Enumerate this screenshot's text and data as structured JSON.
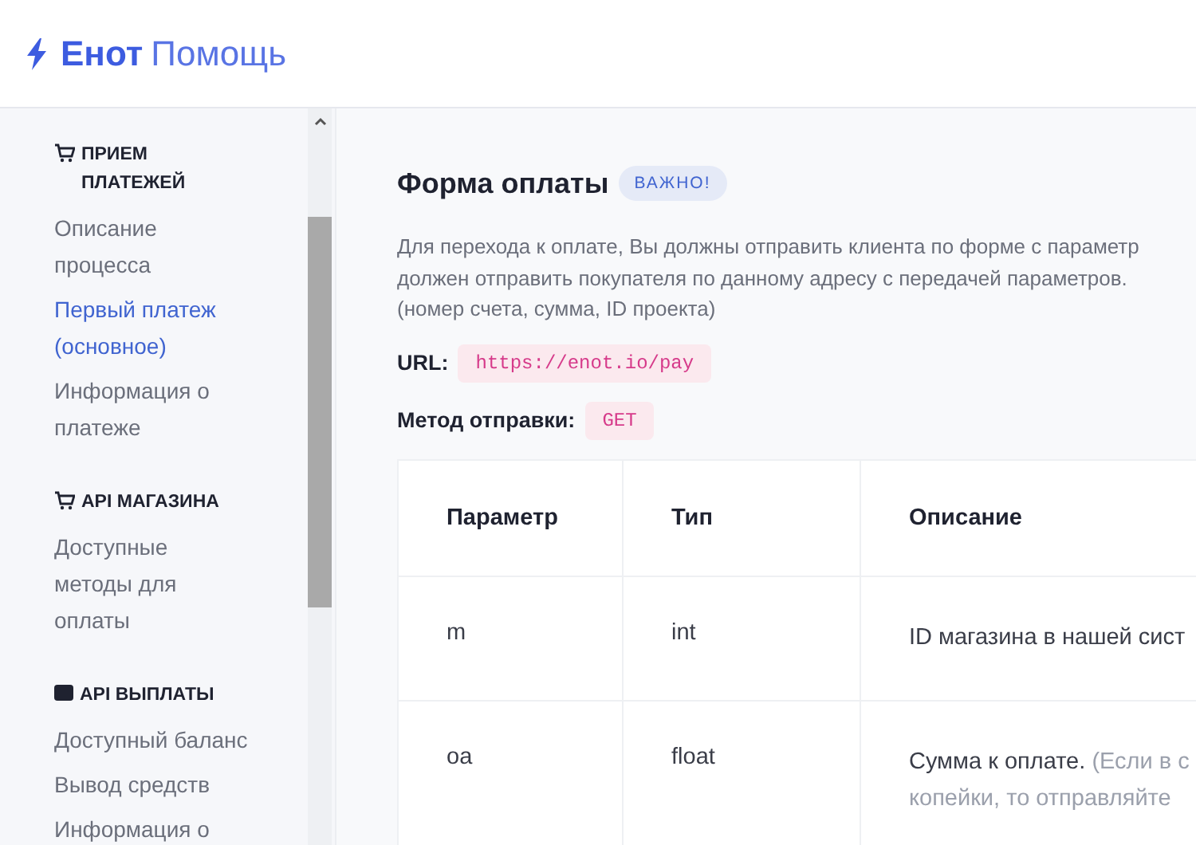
{
  "header": {
    "logo_bold": "Енот",
    "logo_light": "Помощь"
  },
  "sidebar": {
    "sections": [
      {
        "title": "ПРИЕМ\nПЛАТЕЖЕЙ",
        "items": [
          {
            "label": "Описание\nпроцесса",
            "selected": false
          },
          {
            "label": "Первый платеж\n(основное)",
            "selected": true
          },
          {
            "label": "Информация о\nплатеже",
            "selected": false
          }
        ]
      },
      {
        "title": "API МАГАЗИНА",
        "items": [
          {
            "label": "Доступные\nметоды для\nоплаты",
            "selected": false
          }
        ]
      },
      {
        "title": "API ВЫПЛАТЫ",
        "items": [
          {
            "label": "Доступный баланс",
            "selected": false
          },
          {
            "label": "Вывод средств",
            "selected": false
          },
          {
            "label": "Информация о",
            "selected": false
          }
        ]
      }
    ]
  },
  "content": {
    "title": "Форма оплаты",
    "badge": "ВАЖНО!",
    "paragraph": "Для перехода к оплате, Вы должны отправить клиента по форме с параметр\nдолжен отправить покупателя по данному адресу с передачей параметров.\n(номер счета, сумма, ID проекта)",
    "fields": [
      {
        "label": "URL:",
        "value": "https://enot.io/pay"
      },
      {
        "label": "Метод отправки:",
        "value": "GET"
      }
    ],
    "table": {
      "columns": [
        "Параметр",
        "Тип",
        "Описание"
      ],
      "rows": [
        {
          "param": "m",
          "type": "int",
          "description": "ID магазина в нашей сист"
        },
        {
          "param": "oa",
          "type": "float",
          "description": "Сумма к оплате.",
          "note_lines": [
            "(Если в с",
            "копейки, то отправляйте"
          ]
        }
      ]
    }
  }
}
